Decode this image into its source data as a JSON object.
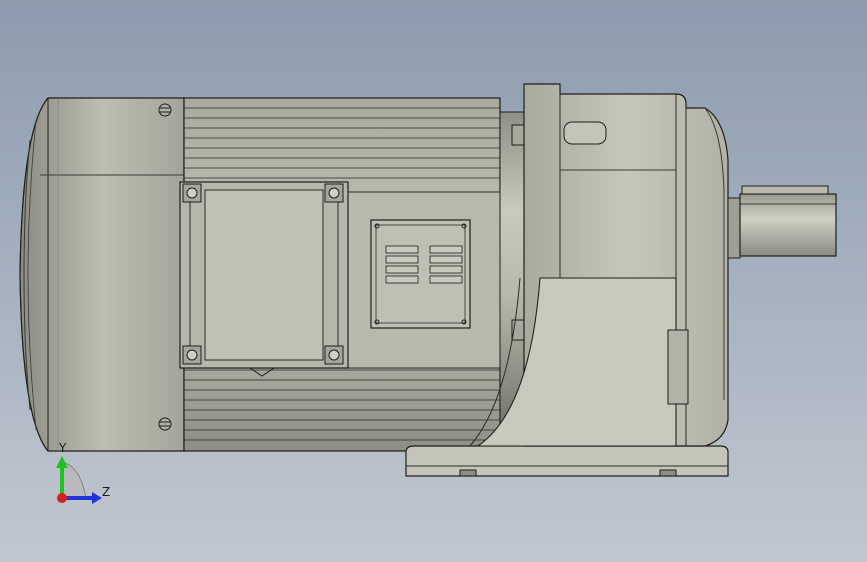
{
  "viewport": {
    "background_top": "#8d9bae",
    "background_bottom": "#c1c7d0"
  },
  "model": {
    "body_color": "#bcbcaf",
    "edge_color": "#1f1f1a",
    "parts": [
      "motor-fan-cover",
      "motor-cooling-fins",
      "terminal-box",
      "nameplate",
      "gear-housing",
      "mounting-foot",
      "output-shaft"
    ]
  },
  "triad": {
    "y_label": "Y",
    "z_label": "Z",
    "y_color": "#1fc21f",
    "z_color": "#2433d9",
    "x_color": "#d42020"
  }
}
